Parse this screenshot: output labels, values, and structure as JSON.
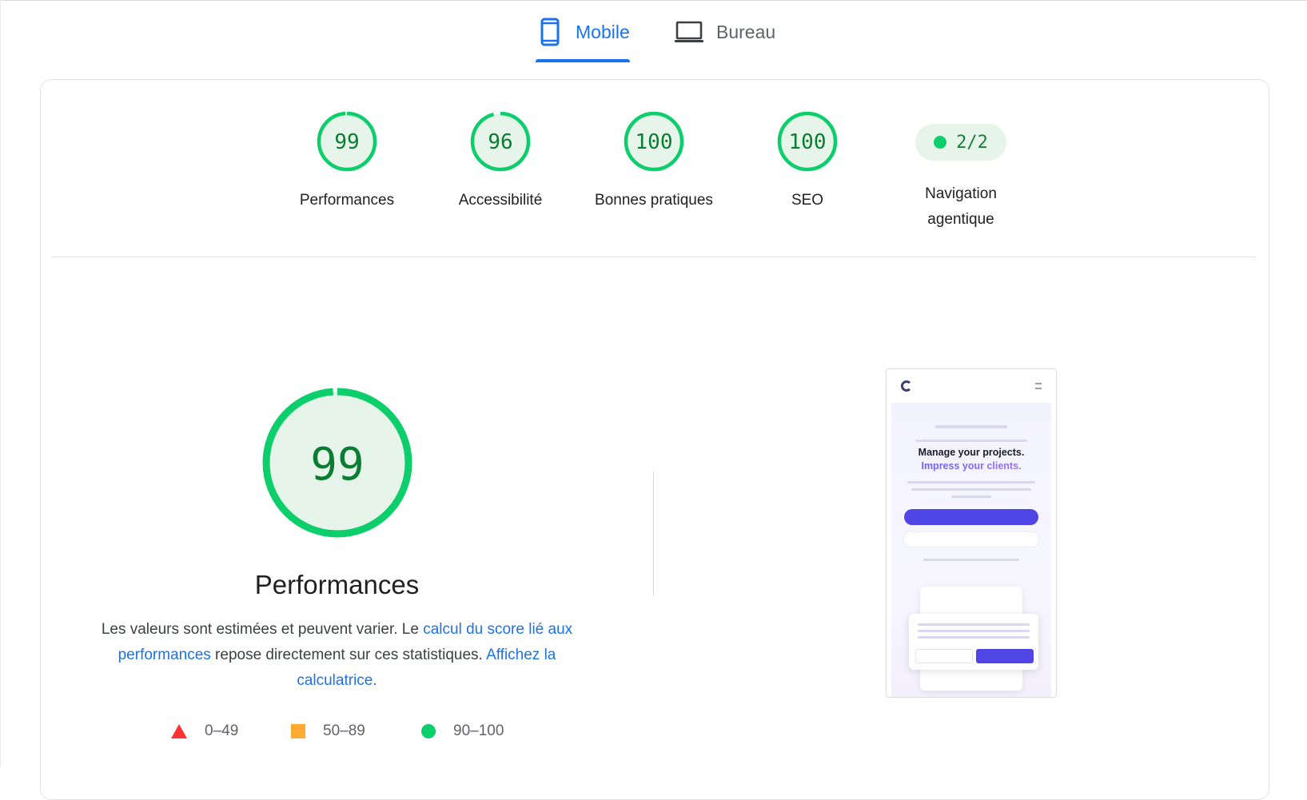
{
  "tabs": [
    {
      "label": "Mobile",
      "icon": "smartphone-icon",
      "active": true
    },
    {
      "label": "Bureau",
      "icon": "laptop-icon",
      "active": false
    }
  ],
  "scores": [
    {
      "value": "99",
      "label": "Performances"
    },
    {
      "value": "96",
      "label": "Accessibilité"
    },
    {
      "value": "100",
      "label": "Bonnes pratiques"
    },
    {
      "value": "100",
      "label": "SEO"
    }
  ],
  "agentic": {
    "value": "2/2",
    "label": "Navigation agentique"
  },
  "main": {
    "score": "99",
    "title": "Performances",
    "desc_part1": "Les valeurs sont estimées et peuvent varier. Le ",
    "desc_link1": "calcul du score lié aux performances",
    "desc_part2": " repose directement sur ces statistiques. ",
    "desc_link2": "Affichez la calculatrice."
  },
  "legend": [
    {
      "range": "0–49",
      "shape": "triangle",
      "color": "#ff3333"
    },
    {
      "range": "50–89",
      "shape": "square",
      "color": "#ffaa33"
    },
    {
      "range": "90–100",
      "shape": "circle",
      "color": "#0cce6b"
    }
  ],
  "screenshot": {
    "headline": "Manage your projects.",
    "headline_accent": "Impress your clients."
  },
  "colors": {
    "accent": "#1a73e8",
    "pass": "#0cce6b",
    "pass_text": "#0a7d32",
    "pass_bg": "#e6f4ea"
  }
}
